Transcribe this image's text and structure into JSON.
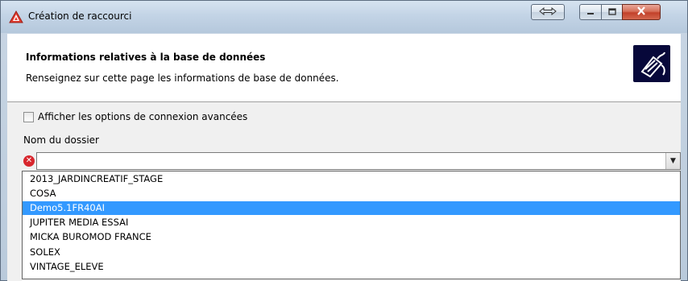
{
  "window": {
    "title": "Création de raccourci"
  },
  "header": {
    "title": "Informations relatives à la base de données",
    "subtitle": "Renseignez sur cette page les informations de base de données."
  },
  "form": {
    "advanced_checkbox_label": "Afficher les options de connexion avancées",
    "advanced_checked": false,
    "folder_label": "Nom du dossier",
    "folder_value": ""
  },
  "dropdown": {
    "items": [
      "2013_JARDINCREATIF_STAGE",
      "COSA",
      "Demo5.1FR40AI",
      "JUPITER MEDIA ESSAI",
      "MICKA BUROMOD FRANCE",
      "SOLEX",
      "VINTAGE_ELEVE"
    ],
    "selected_index": 2
  },
  "icons": {
    "app": "app-logo-icon",
    "resize": "resize-arrows-icon",
    "minimize": "minimize-icon",
    "maximize": "maximize-icon",
    "close": "close-icon",
    "header_logo": "plug-cable-icon",
    "error": "error-icon",
    "combo_arrow": "chevron-down-icon"
  },
  "colors": {
    "selection": "#3399ff",
    "error": "#d8262d",
    "logo_bg": "#07083a"
  }
}
